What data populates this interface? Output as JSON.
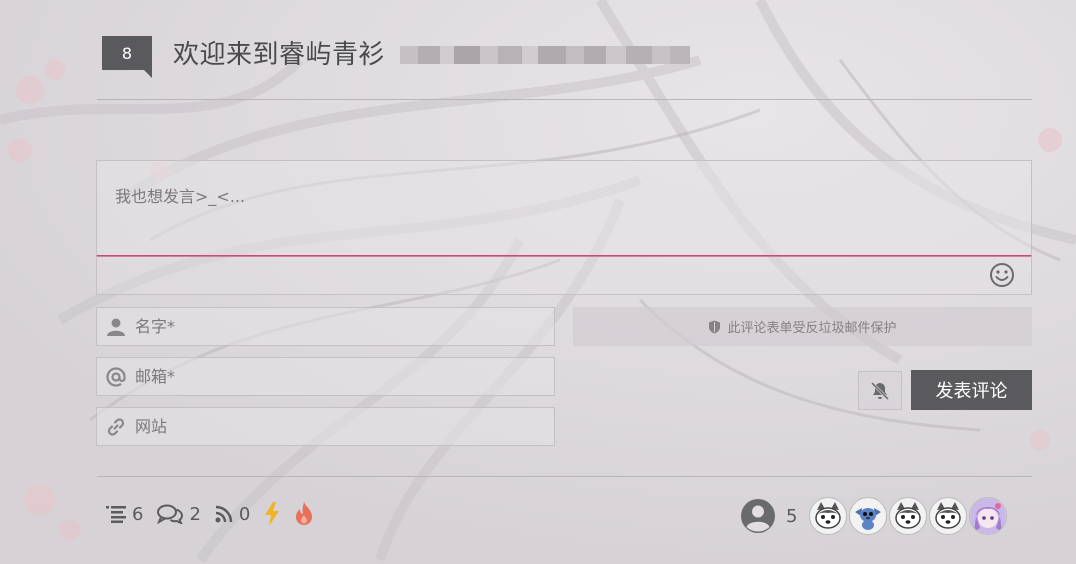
{
  "header": {
    "comment_count": "8",
    "title": "欢迎来到睿屿青衫"
  },
  "comment_form": {
    "textarea_placeholder": "我也想发言>_<...",
    "name_placeholder": "名字*",
    "email_placeholder": "邮箱*",
    "website_placeholder": "网站",
    "spam_notice": "此评论表单受反垃圾邮件保护",
    "submit_label": "发表评论"
  },
  "stats": {
    "posts": "6",
    "comments": "2",
    "feeds": "0"
  },
  "visitors": {
    "count": "5",
    "avatar_icons": [
      "husky-avatar",
      "stitch-avatar",
      "husky-avatar",
      "husky-avatar",
      "anime-girl-avatar"
    ]
  },
  "colors": {
    "accent": "#c94a72",
    "dark_button": "#5a5a5e",
    "lightning": "#f0b429",
    "fire": "#e8705a"
  }
}
